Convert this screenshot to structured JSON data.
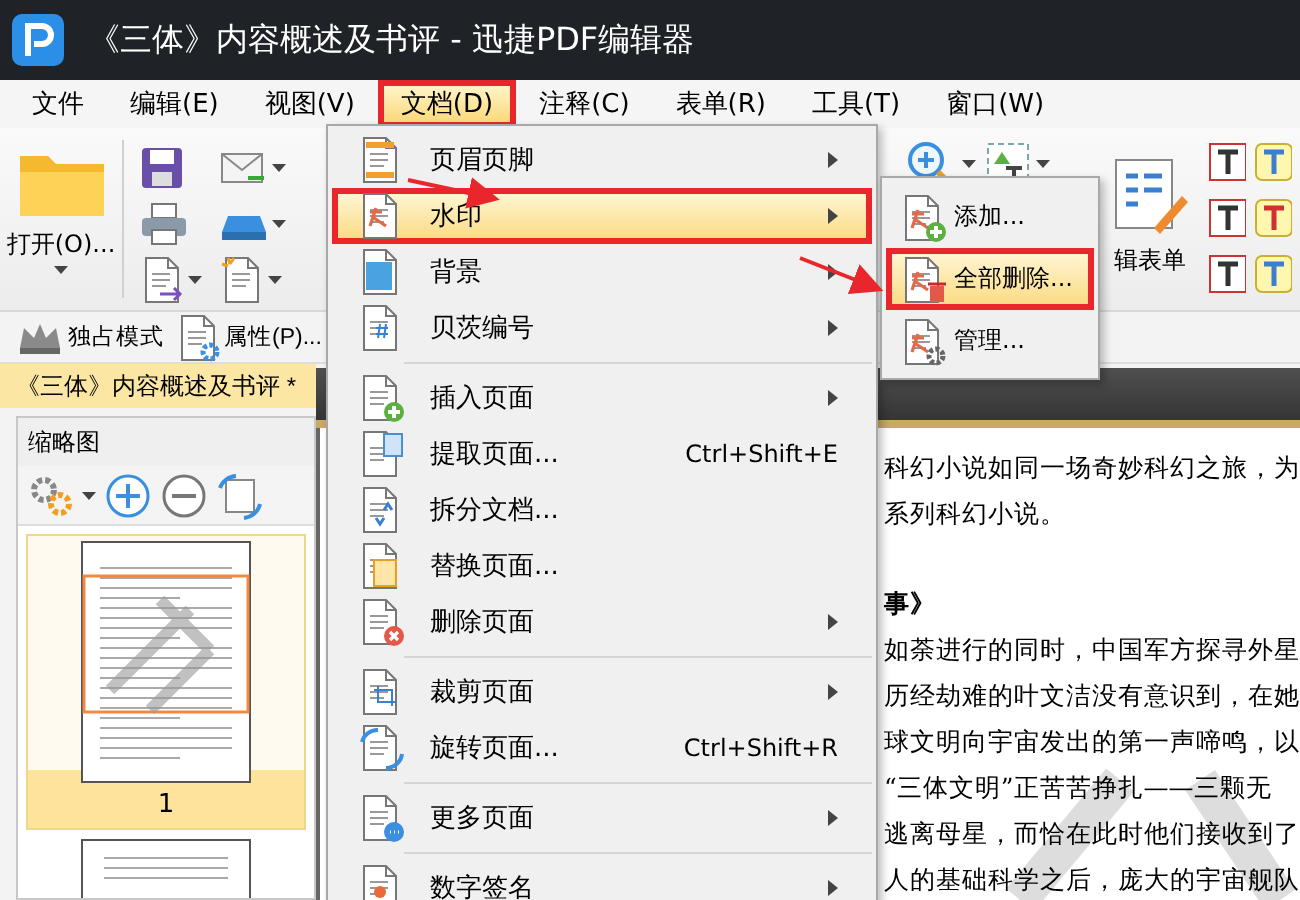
{
  "window": {
    "title": "《三体》内容概述及书评 - 迅捷PDF编辑器"
  },
  "menubar": [
    {
      "label": "文件",
      "selected": false,
      "marked": false
    },
    {
      "label": "编辑(E)",
      "selected": false,
      "marked": false
    },
    {
      "label": "视图(V)",
      "selected": false,
      "marked": false
    },
    {
      "label": "文档(D)",
      "selected": true,
      "marked": true
    },
    {
      "label": "注释(C)",
      "selected": false,
      "marked": false
    },
    {
      "label": "表单(R)",
      "selected": false,
      "marked": false
    },
    {
      "label": "工具(T)",
      "selected": false,
      "marked": false
    },
    {
      "label": "窗口(W)",
      "selected": false,
      "marked": false
    }
  ],
  "toolbar": {
    "open_label": "打开(O)...",
    "form_label": "辑表单"
  },
  "mode_bar": {
    "items": [
      "独占模式",
      "属性(P)..."
    ]
  },
  "document_tab": {
    "title": "《三体》内容概述及书评 *"
  },
  "thumbnail_panel": {
    "title": "缩略图",
    "pages": [
      {
        "label": "1",
        "selected": true
      }
    ]
  },
  "document": {
    "lines": [
      {
        "kind": "body",
        "text": "科幻小说如同一场奇妙科幻之旅，为"
      },
      {
        "kind": "body",
        "text": "系列科幻小说。"
      },
      {
        "kind": "heading",
        "text": "事》"
      },
      {
        "kind": "body",
        "text": "如荼进行的同时，中国军方探寻外星"
      },
      {
        "kind": "body",
        "text": "历经劫难的叶文洁没有意识到，在她"
      },
      {
        "kind": "body",
        "text": "球文明向宇宙发出的第一声啼鸣，以"
      },
      {
        "kind": "body",
        "text": "“三体文明”正苦苦挣扎——三颗无"
      },
      {
        "kind": "body",
        "text": "逃离母星，而恰在此时他们接收到了"
      },
      {
        "kind": "body",
        "text": "人的基础科学之后，庞大的宇宙舰队"
      }
    ]
  },
  "menu": {
    "items": [
      {
        "kind": "item",
        "label": "页眉页脚",
        "has_submenu": true,
        "selected": false,
        "marked": false
      },
      {
        "kind": "item",
        "label": "水印",
        "has_submenu": true,
        "selected": true,
        "marked": true
      },
      {
        "kind": "item",
        "label": "背景",
        "has_submenu": true,
        "selected": false,
        "marked": false
      },
      {
        "kind": "item",
        "label": "贝茨编号",
        "has_submenu": true,
        "selected": false,
        "marked": false
      },
      {
        "kind": "separator"
      },
      {
        "kind": "item",
        "label": "插入页面",
        "has_submenu": true,
        "selected": false,
        "marked": false
      },
      {
        "kind": "item",
        "label": "提取页面...",
        "shortcut": "Ctrl+Shift+E",
        "has_submenu": false,
        "selected": false,
        "marked": false
      },
      {
        "kind": "item",
        "label": "拆分文档...",
        "has_submenu": false,
        "selected": false,
        "marked": false
      },
      {
        "kind": "item",
        "label": "替换页面...",
        "has_submenu": false,
        "selected": false,
        "marked": false
      },
      {
        "kind": "item",
        "label": "删除页面",
        "has_submenu": true,
        "selected": false,
        "marked": false
      },
      {
        "kind": "separator"
      },
      {
        "kind": "item",
        "label": "裁剪页面",
        "has_submenu": true,
        "selected": false,
        "marked": false
      },
      {
        "kind": "item",
        "label": "旋转页面...",
        "shortcut": "Ctrl+Shift+R",
        "has_submenu": false,
        "selected": false,
        "marked": false
      },
      {
        "kind": "separator"
      },
      {
        "kind": "item",
        "label": "更多页面",
        "has_submenu": true,
        "selected": false,
        "marked": false
      },
      {
        "kind": "separator"
      },
      {
        "kind": "item",
        "label": "数字签名",
        "has_submenu": true,
        "selected": false,
        "marked": false
      }
    ]
  },
  "submenu": {
    "items": [
      {
        "label": "添加...",
        "selected": false,
        "marked": false
      },
      {
        "label": "全部删除...",
        "selected": true,
        "marked": true
      },
      {
        "label": "管理...",
        "selected": false,
        "marked": false
      }
    ]
  }
}
